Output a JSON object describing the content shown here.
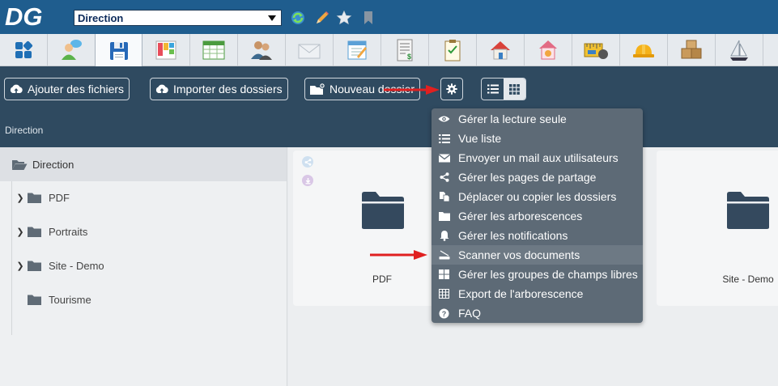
{
  "header": {
    "logo_text": "DG",
    "directory_select_value": "Direction"
  },
  "modules": [
    {
      "icon": "dashboard-grid-icon",
      "active": false
    },
    {
      "icon": "users-chat-icon",
      "active": false
    },
    {
      "icon": "floppy-disk-icon",
      "active": true
    },
    {
      "icon": "kanban-board-icon",
      "active": false
    },
    {
      "icon": "spreadsheet-icon",
      "active": false
    },
    {
      "icon": "contacts-icon",
      "active": false
    },
    {
      "icon": "envelope-icon",
      "active": false
    },
    {
      "icon": "notepad-icon",
      "active": false
    },
    {
      "icon": "invoice-icon",
      "active": false
    },
    {
      "icon": "checklist-icon",
      "active": false
    },
    {
      "icon": "house-icon",
      "active": false
    },
    {
      "icon": "home-gear-icon",
      "active": false
    },
    {
      "icon": "measuring-tape-icon",
      "active": false
    },
    {
      "icon": "hard-hat-icon",
      "active": false
    },
    {
      "icon": "boxes-icon",
      "active": false
    },
    {
      "icon": "sailboat-icon",
      "active": false
    }
  ],
  "toolbar": {
    "add_files_label": "Ajouter des fichiers",
    "import_folders_label": "Importer des dossiers",
    "new_folder_label": "Nouveau dossier",
    "breadcrumb": "Direction"
  },
  "sidebar": {
    "root_label": "Direction",
    "items": [
      {
        "label": "PDF",
        "expandable": true
      },
      {
        "label": "Portraits",
        "expandable": true
      },
      {
        "label": "Site - Demo",
        "expandable": true
      },
      {
        "label": "Tourisme",
        "expandable": false
      }
    ]
  },
  "main": {
    "cards": [
      {
        "label": "PDF"
      },
      {
        "label": "Site - Demo"
      }
    ]
  },
  "menu": {
    "items": [
      {
        "label": "Gérer la lecture seule",
        "icon": "eye-icon"
      },
      {
        "label": "Vue liste",
        "icon": "list-icon"
      },
      {
        "label": "Envoyer un mail aux utilisateurs",
        "icon": "envelope-icon"
      },
      {
        "label": "Gérer les pages de partage",
        "icon": "share-icon"
      },
      {
        "label": "Déplacer ou copier les dossiers",
        "icon": "copy-move-icon"
      },
      {
        "label": "Gérer les arborescences",
        "icon": "folder-icon"
      },
      {
        "label": "Gérer les notifications",
        "icon": "bell-icon"
      },
      {
        "label": "Scanner vos documents",
        "icon": "scanner-icon",
        "highlighted": true
      },
      {
        "label": "Gérer les groupes de champs libres",
        "icon": "fields-grid-icon"
      },
      {
        "label": "Export de l'arborescence",
        "icon": "table-export-icon"
      },
      {
        "label": "FAQ",
        "icon": "question-icon"
      }
    ]
  },
  "colors": {
    "topbar": "#1f5d8e",
    "toolbar": "#2f4a60",
    "menu": "#5d6a76",
    "folder": "#34495e",
    "arrow": "#e02020"
  }
}
